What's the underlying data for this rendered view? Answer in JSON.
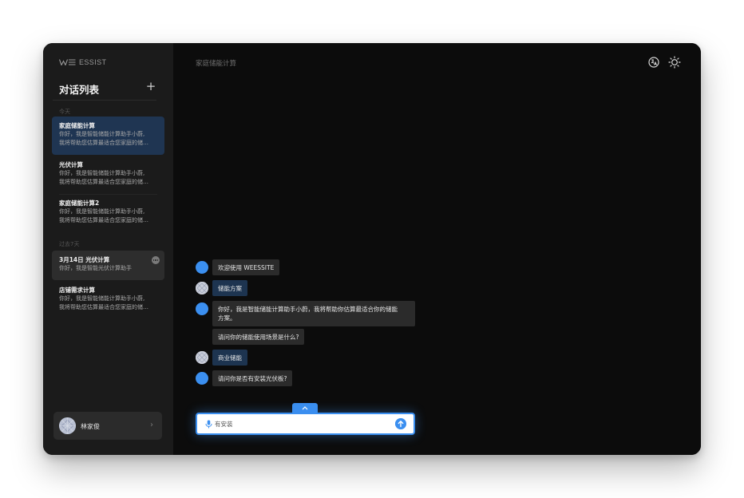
{
  "app": {
    "logo_text": "ESSIST"
  },
  "sidebar": {
    "title": "对话列表",
    "add_label": "+",
    "groups": [
      {
        "label": "今天"
      },
      {
        "label": "过去7天"
      }
    ],
    "conversations": [
      {
        "title": "家庭储能计算",
        "preview1": "你好，我是智能储能计算助手小蔚,",
        "preview2": "我将帮助您估算最适合您家庭的储…"
      },
      {
        "title": "光伏计算",
        "preview1": "你好，我是智能储能计算助手小蔚,",
        "preview2": "我将帮助您估算最适合您家庭的储…"
      },
      {
        "title": "家庭储能计算2",
        "preview1": "你好，我是智能储能计算助手小蔚,",
        "preview2": "我将帮助您估算最适合您家庭的储…"
      },
      {
        "title": "3月14日 光伏计算",
        "preview1": "你好，我是智能光伏计算助手"
      },
      {
        "title": "店铺需求计算",
        "preview1": "你好，我是智能储能计算助手小蔚,",
        "preview2": "我将帮助您估算最适合您家庭的储…"
      }
    ],
    "user": {
      "name": "林家俊",
      "chevron": "›"
    }
  },
  "header": {
    "title": "家庭储能计算",
    "icons": [
      "language-icon",
      "theme-sun-icon"
    ]
  },
  "chat": {
    "messages": [
      {
        "role": "bot",
        "text": "欢迎使用 WEESSITE"
      },
      {
        "role": "user",
        "text": "储能方案"
      },
      {
        "role": "bot",
        "line1": "你好，我是智能储能计算助手小蔚，我将帮助你估算最适合你的储能",
        "line2": "方案。"
      },
      {
        "role": "bot",
        "text": "请问你的储能使用场景是什么?"
      },
      {
        "role": "user",
        "text": "商业储能"
      },
      {
        "role": "bot",
        "text": "请问你是否有安装光伏板?"
      }
    ]
  },
  "composer": {
    "value": "有安装",
    "placeholder": ""
  },
  "colors": {
    "accent": "#3b8ff0",
    "sidebar_bg": "#1b1b1b",
    "main_bg": "#0c0c0c",
    "active_item": "#1f3552"
  }
}
